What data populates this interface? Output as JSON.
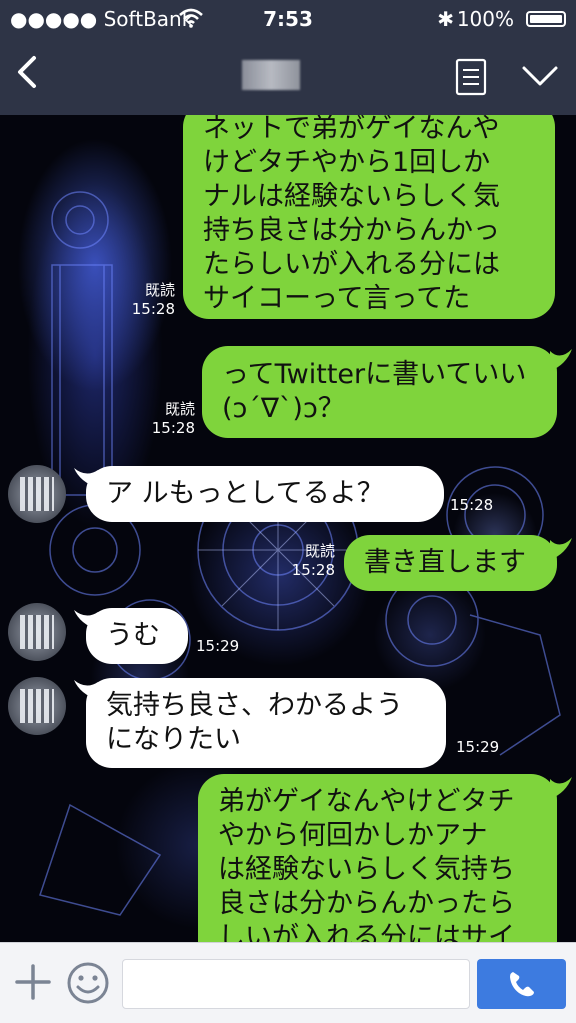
{
  "status_bar": {
    "carrier": "●●●●● SoftBank",
    "time": "7:53",
    "battery": "100%",
    "bluetooth": "✱"
  },
  "header": {
    "back_icon": "chevron-left-icon",
    "menu_icon": "note-icon",
    "expand_icon": "chevron-down-icon"
  },
  "colors": {
    "header_bg": "#2e3446",
    "green_bubble": "#7fd43c",
    "white_bubble": "#ffffff",
    "send_button": "#3d7be0"
  },
  "messages": [
    {
      "side": "right",
      "text": "ネットで弟がゲイなんや\nけどタチやから1回しか\nナルは経験ないらしく気\n持ち良さは分からんかっ\nたらしいが入れる分には\nサイコーって言ってた",
      "read": "既読",
      "time": "15:28"
    },
    {
      "side": "right",
      "text": "ってTwitterに書いていい\n(ↄ´∇`)ↄ？",
      "read": "既読",
      "time": "15:28"
    },
    {
      "side": "left",
      "text": "ア ルもっとしてるよ？",
      "time": "15:28"
    },
    {
      "side": "right",
      "text": "書き直します",
      "read": "既読",
      "time": "15:28"
    },
    {
      "side": "left",
      "text": "うむ",
      "time": "15:29"
    },
    {
      "side": "left",
      "text": "気持ち良さ、わかるよう\nになりたい",
      "time": "15:29"
    },
    {
      "side": "right",
      "text": "弟がゲイなんやけどタチ\nやから何回かしかアナ\nは経験ないらしく気持ち\n良さは分からんかったら\nしいが入れる分にはサイ"
    }
  ],
  "input_bar": {
    "plus_icon": "plus-icon",
    "emoji_icon": "smiley-icon",
    "text_value": "",
    "call_icon": "phone-icon"
  }
}
